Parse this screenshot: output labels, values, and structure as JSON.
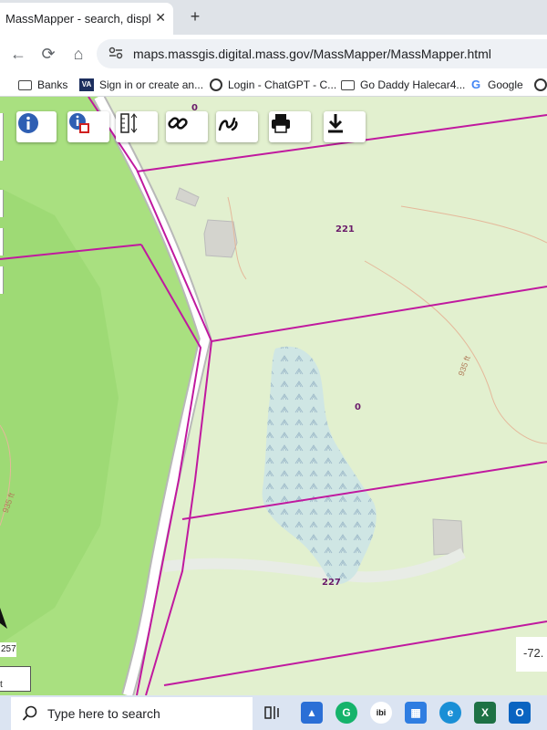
{
  "tab": {
    "title": "MassMapper - search, display, c",
    "close": "✕",
    "new_tab": "+"
  },
  "toolbar": {
    "back": "←",
    "reload": "⟳",
    "home": "⌂",
    "url": "maps.massgis.digital.mass.gov/MassMapper/MassMapper.html"
  },
  "bookmarks": [
    {
      "label": "Banks",
      "icon": "folder-icon"
    },
    {
      "label": "Sign in or create an...",
      "icon": "va-icon"
    },
    {
      "label": "Login - ChatGPT - C...",
      "icon": "chatgpt-icon"
    },
    {
      "label": "Go Daddy Halecar4...",
      "icon": "folder-icon"
    },
    {
      "label": "Google",
      "icon": "google-icon"
    }
  ],
  "map": {
    "parcels": [
      "221",
      "0",
      "227",
      "0"
    ],
    "coordinate": "-72.",
    "scale_number": "257",
    "scale_unit": "t",
    "contour_labels": [
      "935 ft",
      "935 ft"
    ],
    "tools": [
      "info-icon",
      "identify-icon",
      "measure-icon",
      "link-icon",
      "draw-icon",
      "print-icon",
      "download-icon"
    ]
  },
  "taskbar": {
    "search_placeholder": "Type here to search"
  },
  "colors": {
    "parcel_line": "#c0199f",
    "road": "#ffffff",
    "wetland": "#cfe6e4",
    "forest": "#a6df7e",
    "open": "#e2f0cf"
  }
}
